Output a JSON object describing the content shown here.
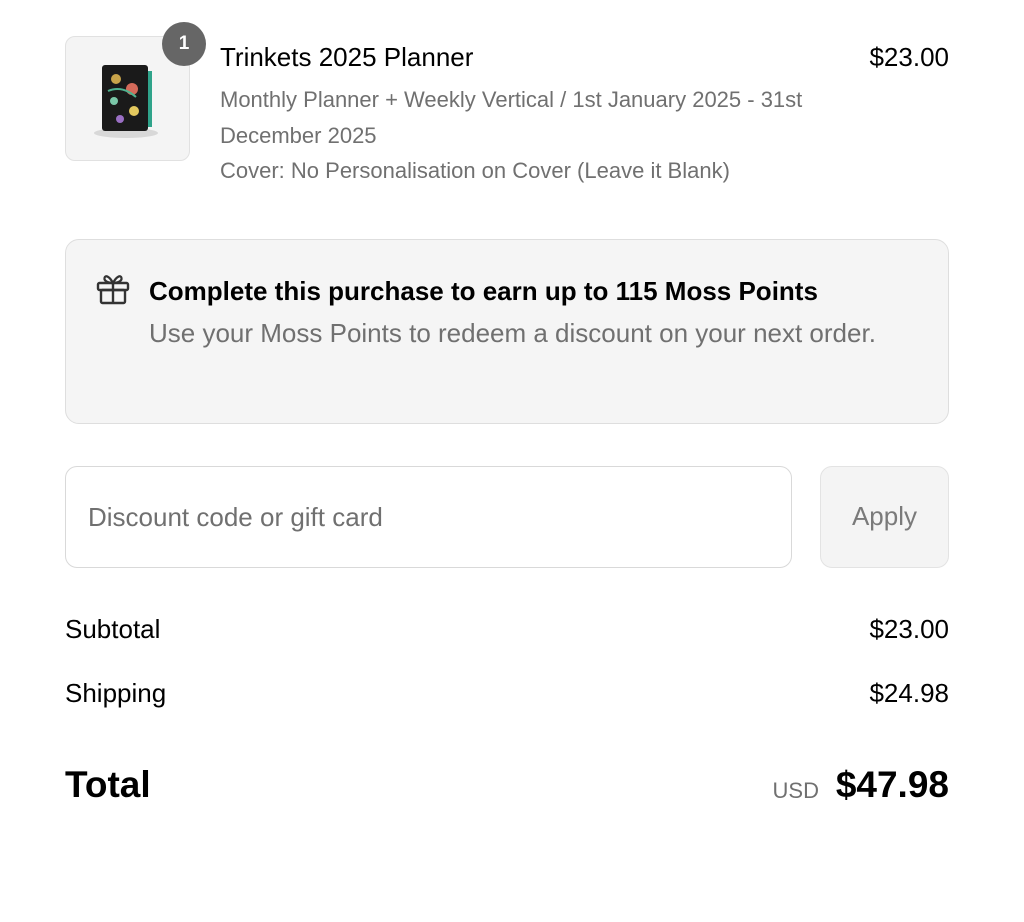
{
  "line_item": {
    "quantity": "1",
    "title": "Trinkets 2025 Planner",
    "price": "$23.00",
    "variant": "Monthly Planner + Weekly Vertical / 1st January 2025 - 31st December 2025",
    "cover": "Cover: No Personalisation on Cover (Leave it Blank)",
    "thumbnail_icon": "planner-thumbnail"
  },
  "rewards": {
    "icon": "gift-icon",
    "title": "Complete this purchase to earn up to 115 Moss Points",
    "body": "Use your Moss Points to redeem a discount on your next order."
  },
  "discount": {
    "placeholder": "Discount code or gift card",
    "value": "",
    "apply_label": "Apply"
  },
  "summary": {
    "subtotal_label": "Subtotal",
    "subtotal_value": "$23.00",
    "shipping_label": "Shipping",
    "shipping_value": "$24.98",
    "total_label": "Total",
    "currency": "USD",
    "total_value": "$47.98"
  },
  "colors": {
    "badge": "#666666",
    "muted_text": "#707070",
    "banner_bg": "#f5f5f5",
    "border": "#dedede"
  }
}
